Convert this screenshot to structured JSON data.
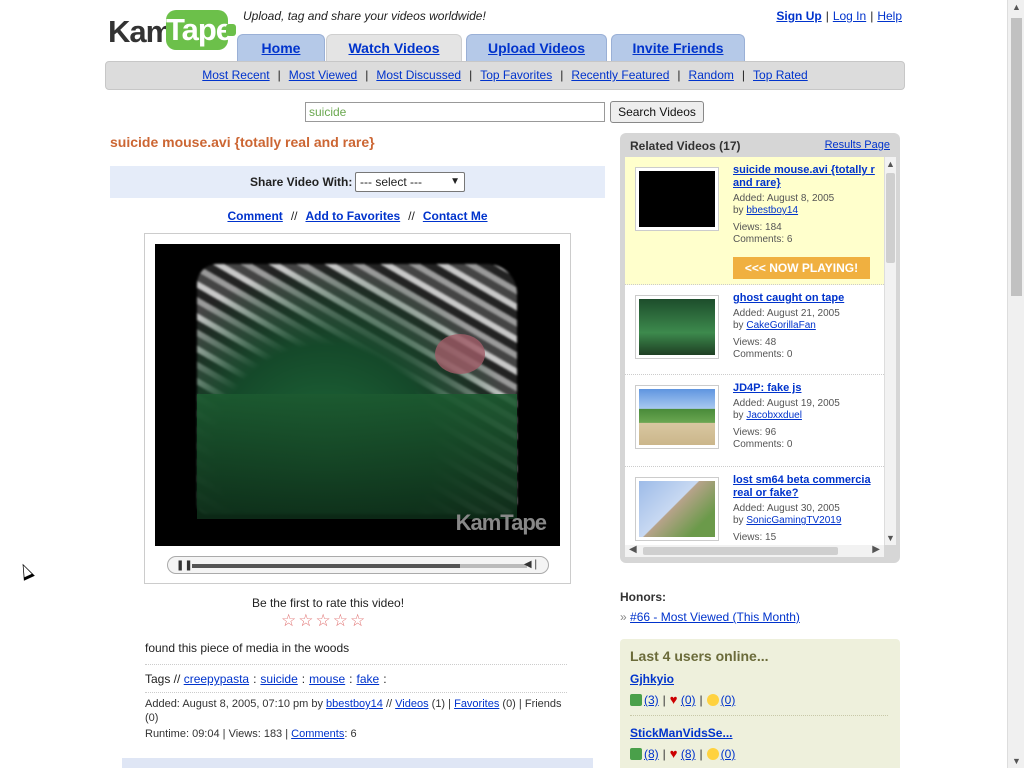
{
  "header": {
    "logo_part1": "Kam",
    "logo_part2": "Tape",
    "tagline": "Upload, tag and share your videos worldwide!",
    "sign_up": "Sign Up",
    "log_in": "Log In",
    "help": "Help",
    "sep": "|"
  },
  "tabs": [
    {
      "label": "Home"
    },
    {
      "label": "Watch Videos"
    },
    {
      "label": "Upload Videos"
    },
    {
      "label": "Invite Friends"
    }
  ],
  "subnav": [
    "Most Recent",
    "Most Viewed",
    "Most Discussed",
    "Top Favorites",
    "Recently Featured",
    "Random",
    "Top Rated"
  ],
  "search": {
    "value": "suicide",
    "button": "Search Videos"
  },
  "video": {
    "title": "suicide mouse.avi {totally real and rare}",
    "share_label": "Share Video With:",
    "share_select": "--- select ---",
    "actions": [
      "Comment",
      "Add to Favorites",
      "Contact Me"
    ],
    "action_sep": "//",
    "watermark": "KamTape",
    "progress": 0.8,
    "rate_prompt": "Be the first to rate this video!",
    "stars": "☆☆☆☆☆",
    "description": "found this piece of media in the woods",
    "tags_label": "Tags //",
    "tags": [
      "creepypasta",
      "suicide",
      "mouse",
      "fake"
    ],
    "added_prefix": "Added: August 8, 2005, 07:10 pm by",
    "author": "bbestboy14",
    "videos_link": "Videos",
    "videos_count": "(1)",
    "favorites_link": "Favorites",
    "favorites_count": "(0)",
    "friends_text": "Friends (0)",
    "runtime_text": "Runtime: 09:04 | Views: 183 |",
    "comments_link": "Comments",
    "comments_count": ": 6"
  },
  "related": {
    "header": "Related Videos (17)",
    "results_page": "Results Page",
    "now_playing": "<<< NOW PLAYING!",
    "items": [
      {
        "title": "suicide mouse.avi {totally r and rare}",
        "added": "Added: August 8, 2005",
        "by": "by",
        "author": "bbestboy14",
        "views": "Views: 184",
        "comments": "Comments: 6",
        "thumb": "#000000"
      },
      {
        "title": "ghost caught on tape",
        "added": "Added: August 21, 2005",
        "by": "by",
        "author": "CakeGorillaFan",
        "views": "Views: 48",
        "comments": "Comments: 0",
        "thumb": "#2f6b3a"
      },
      {
        "title": "JD4P: fake js",
        "added": "Added: August 19, 2005",
        "by": "by",
        "author": "Jacobxxduel",
        "views": "Views: 96",
        "comments": "Comments: 0",
        "thumb": "#7bb0e8"
      },
      {
        "title": "lost sm64 beta commercia real or fake?",
        "added": "Added: August 30, 2005",
        "by": "by",
        "author": "SonicGamingTV2019",
        "views": "Views: 15",
        "comments": "",
        "thumb": "#a9c7ee"
      }
    ]
  },
  "honors": {
    "label": "Honors:",
    "bullet": "»",
    "item": "#66 - Most Viewed (This Month)"
  },
  "users": {
    "header": "Last 4 users online...",
    "list": [
      {
        "name": "Gjhkyio",
        "videos": "(3)",
        "favorites": "(0)",
        "friends": "(0)"
      },
      {
        "name": "StickManVidsSe...",
        "videos": "(8)",
        "favorites": "(8)",
        "friends": "(0)"
      }
    ]
  },
  "colors": {
    "accent": "#0033cc",
    "title": "#cc6633",
    "logo_green": "#6cc04a",
    "now_playing": "#f0b040"
  }
}
